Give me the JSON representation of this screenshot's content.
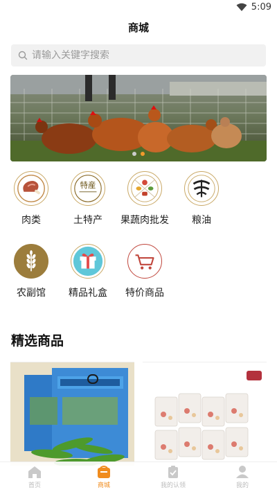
{
  "status": {
    "time": "5:09"
  },
  "header": {
    "title": "商城"
  },
  "search": {
    "placeholder": "请输入关键字搜索"
  },
  "banner": {
    "dots": 2,
    "active_index": 1
  },
  "categories": [
    {
      "label": "肉类",
      "icon": "meat-icon"
    },
    {
      "label": "土特产",
      "icon": "local-specialty-icon"
    },
    {
      "label": "果蔬肉批发",
      "icon": "produce-wholesale-icon"
    },
    {
      "label": "粮油",
      "icon": "grain-oil-icon"
    },
    {
      "label": "农副馆",
      "icon": "wheat-icon"
    },
    {
      "label": "精品礼盒",
      "icon": "gift-box-icon"
    },
    {
      "label": "特价商品",
      "icon": "shopping-cart-icon"
    }
  ],
  "featured": {
    "title": "精选商品"
  },
  "tabbar": {
    "items": [
      {
        "label": "首页",
        "icon": "home-icon",
        "active": false
      },
      {
        "label": "商城",
        "icon": "shop-icon",
        "active": true
      },
      {
        "label": "我的认领",
        "icon": "clipboard-icon",
        "active": false
      },
      {
        "label": "我的",
        "icon": "user-icon",
        "active": false
      }
    ]
  },
  "colors": {
    "accent": "#f08c1e",
    "gold_border": "#c9a865",
    "search_bg": "#f1f1f1"
  }
}
